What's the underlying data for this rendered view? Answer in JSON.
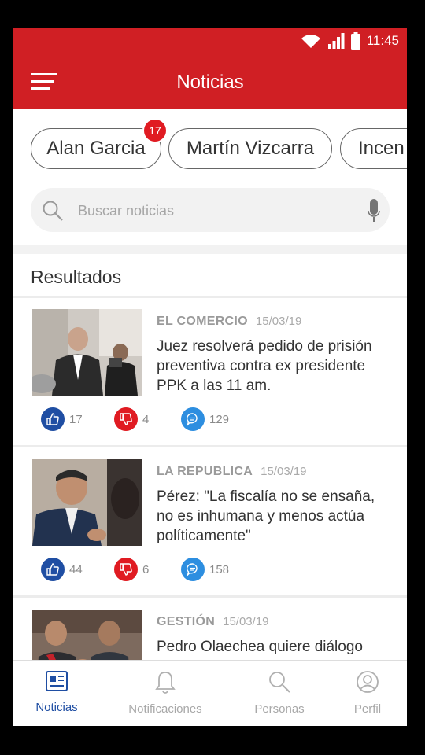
{
  "status_bar": {
    "time": "11:45"
  },
  "app_bar": {
    "title": "Noticias"
  },
  "chips": [
    {
      "label": "Alan Garcia",
      "badge": "17"
    },
    {
      "label": "Martín Vizcarra"
    },
    {
      "label": "Incen"
    }
  ],
  "search": {
    "placeholder": "Buscar noticias"
  },
  "section": {
    "title": "Resultados"
  },
  "articles": [
    {
      "source": "EL COMERCIO",
      "date": "15/03/19",
      "headline": "Juez resolverá pedido de prisión preventiva contra ex presidente PPK a las 11 am.",
      "likes": "17",
      "dislikes": "4",
      "comments": "129"
    },
    {
      "source": "LA REPUBLICA",
      "date": "15/03/19",
      "headline": "Pérez: \"La fiscalía no se ensaña, no es inhumana y menos actúa políticamente\"",
      "likes": "44",
      "dislikes": "6",
      "comments": "158"
    },
    {
      "source": "GESTIÓN",
      "date": "15/03/19",
      "headline": "Pedro Olaechea quiere diálogo"
    }
  ],
  "bottom_nav": [
    {
      "label": "Noticias",
      "icon": "newspaper-icon",
      "active": true
    },
    {
      "label": "Notificaciones",
      "icon": "bell-icon"
    },
    {
      "label": "Personas",
      "icon": "search-icon"
    },
    {
      "label": "Perfil",
      "icon": "person-icon"
    }
  ],
  "colors": {
    "primary": "#d01f24",
    "active_nav": "#1f4ea3",
    "like": "#1f4ea3",
    "dislike": "#e01b22",
    "comment": "#2d8ee0"
  }
}
